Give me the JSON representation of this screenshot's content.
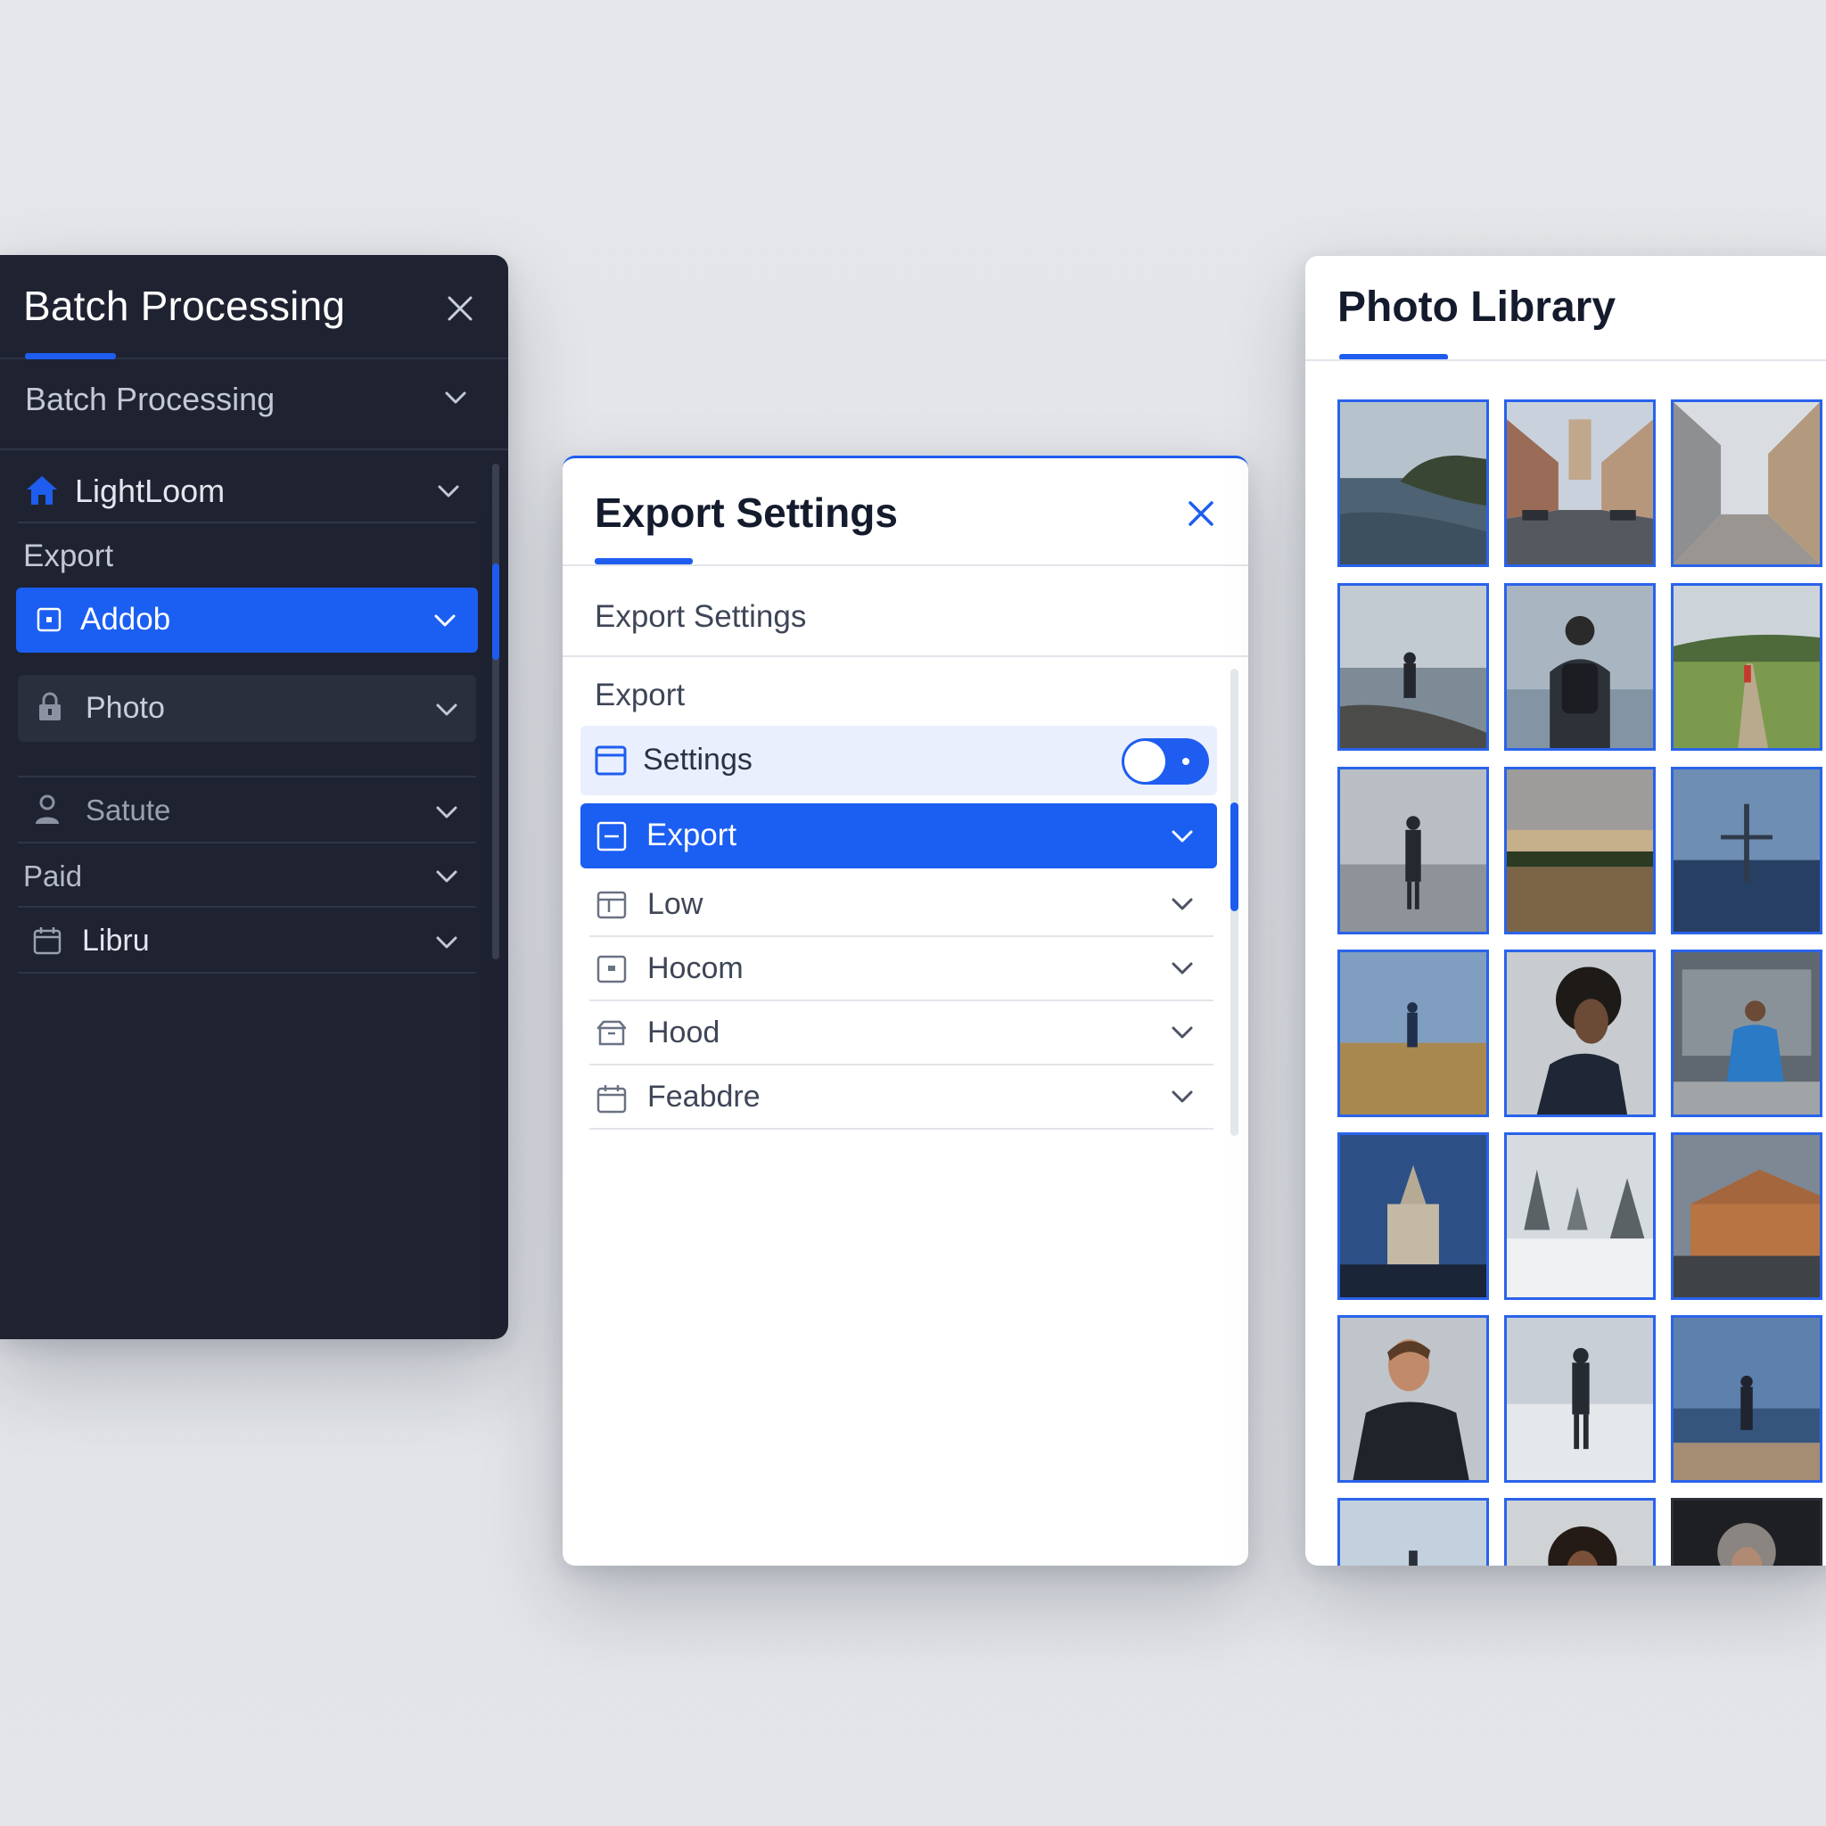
{
  "batch_panel": {
    "title": "Batch Processing",
    "dropdown_label": "Batch Processing",
    "items": [
      {
        "label": "LightLoom",
        "icon": "home-icon"
      },
      {
        "label": "Export",
        "icon": ""
      },
      {
        "label": "Addob",
        "icon": "square-dot-icon"
      },
      {
        "label": "Photo",
        "icon": "lock-icon"
      },
      {
        "label": "Satute",
        "icon": "user-icon"
      },
      {
        "label": "Paid",
        "icon": ""
      },
      {
        "label": "Libru",
        "icon": "calendar-icon"
      }
    ]
  },
  "export_panel": {
    "title": "Export Settings",
    "subtitle": "Export Settings",
    "section": "Export",
    "settings_label": "Settings",
    "settings_toggle_on": true,
    "items": [
      {
        "label": "Export",
        "icon": "minus-square-icon"
      },
      {
        "label": "Low",
        "icon": "layout-icon"
      },
      {
        "label": "Hocom",
        "icon": "square-dot-icon"
      },
      {
        "label": "Hood",
        "icon": "box-icon"
      },
      {
        "label": "Feabdre",
        "icon": "calendar-icon"
      }
    ]
  },
  "library_panel": {
    "title": "Photo Library",
    "photos": [
      "sea-cliff",
      "city-street",
      "alley-street",
      "person-shore",
      "person-backpack-sea",
      "person-meadow-path",
      "person-beach-grey",
      "sunset-lake",
      "cross-sea",
      "person-field",
      "curly-hair-person",
      "person-building",
      "church-night",
      "snowy-forest",
      "wooden-building",
      "young-man-portrait",
      "person-snow-beach",
      "person-pier",
      "person-sky",
      "curly-hair-partial",
      "grey-hair-partial"
    ]
  },
  "colors": {
    "accent": "#1e5df0",
    "dark_panel": "#1f2331",
    "background": "#e2e4e8"
  }
}
